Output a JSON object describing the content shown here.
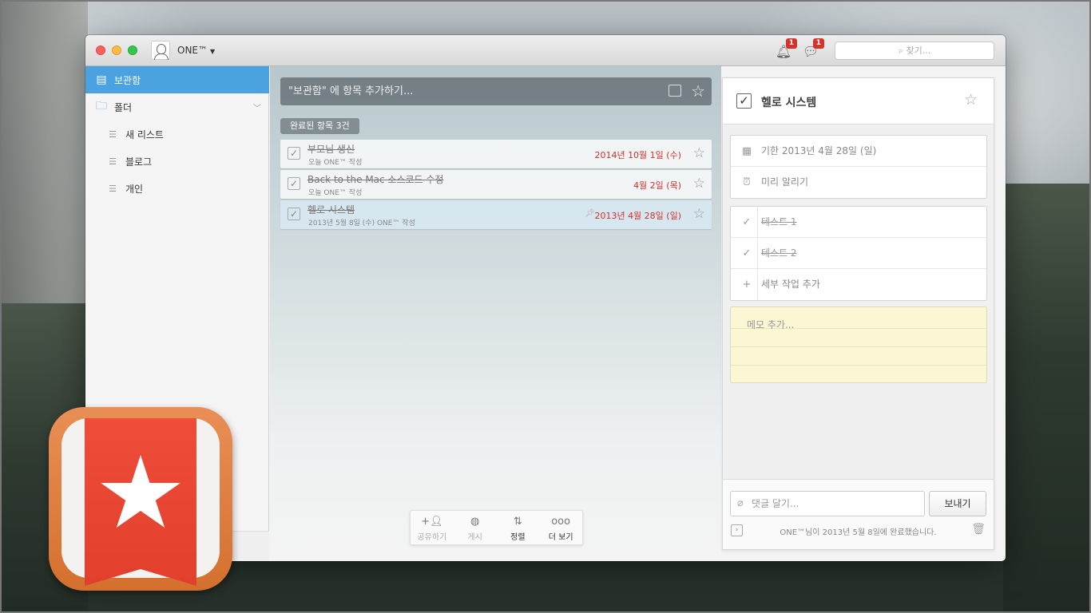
{
  "titlebar": {
    "username": "ONE™",
    "notifications_count": "1",
    "comments_count": "1",
    "search_placeholder": "찾기..."
  },
  "sidebar": {
    "items": [
      {
        "label": "보관함",
        "icon": "inbox-icon"
      },
      {
        "label": "폴더",
        "icon": "folder-icon"
      },
      {
        "label": "새 리스트",
        "icon": "list-icon"
      },
      {
        "label": "블로그",
        "icon": "list-icon"
      },
      {
        "label": "개인",
        "icon": "list-icon"
      }
    ]
  },
  "main": {
    "add_placeholder": "\"보관함\" 에 항목 추가하기...",
    "completed_label": "완료된 항목 3건",
    "tasks": [
      {
        "title": "부모님 생신",
        "sub": "오늘 ONE™ 작성",
        "due": "2014년 10월 1일 (수)"
      },
      {
        "title": "Back to the Mac 소스코드 수정",
        "sub": "오늘 ONE™ 작성",
        "due": "4월 2일 (목)"
      },
      {
        "title": "헬로 시스템",
        "sub": "2013년 5월 8일 (수) ONE™ 작성",
        "due": "2013년 4월 28일 (일)"
      }
    ],
    "toolbar": [
      {
        "label": "공유하기",
        "icon": "share-user-icon"
      },
      {
        "label": "게시",
        "icon": "globe-icon"
      },
      {
        "label": "정렬",
        "icon": "sort-az-icon"
      },
      {
        "label": "더 보기",
        "icon": "more-icon"
      }
    ]
  },
  "detail": {
    "title": "헬로 시스템",
    "due": "기한 2013년 4월 28일 (일)",
    "reminder": "미리 알리기",
    "subtasks": [
      "테스트 1",
      "테스트 2"
    ],
    "add_subtask": "세부 작업 추가",
    "memo_placeholder": "메모 추가...",
    "comment_placeholder": "댓글 달기...",
    "send_label": "보내기",
    "completion_info": "ONE™님이 2013년 5월 8일에 완료했습니다."
  },
  "colors": {
    "accent": "#4aa3e0",
    "due_red": "#d0312d",
    "ribbon": "#ee4d39"
  }
}
